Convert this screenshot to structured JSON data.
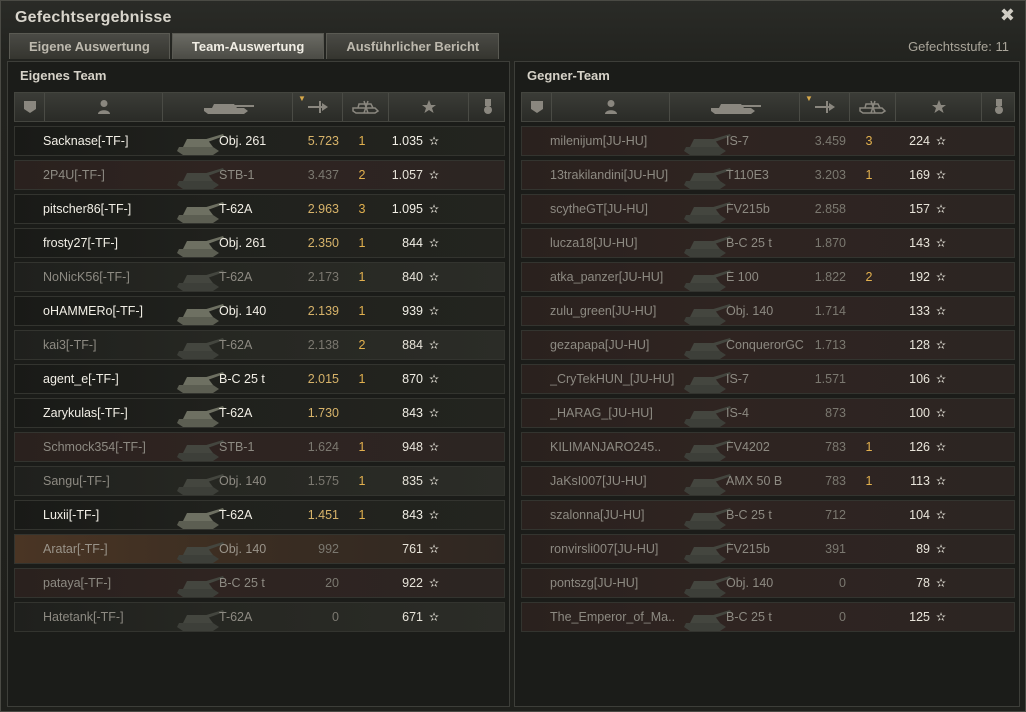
{
  "window": {
    "title": "Gefechtsergebnisse",
    "close_glyph": "✖",
    "tier_label": "Gefechtsstufe: 11"
  },
  "tabs": [
    {
      "label": "Eigene Auswertung",
      "active": false
    },
    {
      "label": "Team-Auswertung",
      "active": true
    },
    {
      "label": "Ausführlicher Bericht",
      "active": false
    }
  ],
  "columns": [
    {
      "icon": "squad-icon"
    },
    {
      "icon": "player-icon"
    },
    {
      "icon": "tank-icon"
    },
    {
      "icon": "damage-icon",
      "sorted": true
    },
    {
      "icon": "kills-icon"
    },
    {
      "icon": "xp-star-icon"
    },
    {
      "icon": "medal-icon"
    }
  ],
  "own_team": {
    "title": "Eigenes Team",
    "players": [
      {
        "name": "Sacknase[-TF-]",
        "tank": "Obj. 261",
        "damage": "5.723",
        "kills": "1",
        "xp": "1.035",
        "alive": true
      },
      {
        "name": "2P4U[-TF-]",
        "tank": "STB-1",
        "damage": "3.437",
        "kills": "2",
        "xp": "1.057",
        "alive": false
      },
      {
        "name": "pitscher86[-TF-]",
        "tank": "T-62A",
        "damage": "2.963",
        "kills": "3",
        "xp": "1.095",
        "alive": true
      },
      {
        "name": "frosty27[-TF-]",
        "tank": "Obj. 261",
        "damage": "2.350",
        "kills": "1",
        "xp": "844",
        "alive": true
      },
      {
        "name": "NoNicK56[-TF-]",
        "tank": "T-62A",
        "damage": "2.173",
        "kills": "1",
        "xp": "840",
        "alive": false
      },
      {
        "name": "oHAMMERo[-TF-]",
        "tank": "Obj. 140",
        "damage": "2.139",
        "kills": "1",
        "xp": "939",
        "alive": true
      },
      {
        "name": "kai3[-TF-]",
        "tank": "T-62A",
        "damage": "2.138",
        "kills": "2",
        "xp": "884",
        "alive": false
      },
      {
        "name": "agent_e[-TF-]",
        "tank": "B-C 25 t",
        "damage": "2.015",
        "kills": "1",
        "xp": "870",
        "alive": true
      },
      {
        "name": "Zarykulas[-TF-]",
        "tank": "T-62A",
        "damage": "1.730",
        "kills": "",
        "xp": "843",
        "alive": true
      },
      {
        "name": "Schmock354[-TF-]",
        "tank": "STB-1",
        "damage": "1.624",
        "kills": "1",
        "xp": "948",
        "alive": false
      },
      {
        "name": "Sangu[-TF-]",
        "tank": "Obj. 140",
        "damage": "1.575",
        "kills": "1",
        "xp": "835",
        "alive": false
      },
      {
        "name": "Luxii[-TF-]",
        "tank": "T-62A",
        "damage": "1.451",
        "kills": "1",
        "xp": "843",
        "alive": true
      },
      {
        "name": "Aratar[-TF-]",
        "tank": "Obj. 140",
        "damage": "992",
        "kills": "",
        "xp": "761",
        "alive": false,
        "highlight": true
      },
      {
        "name": "pataya[-TF-]",
        "tank": "B-C 25 t",
        "damage": "20",
        "kills": "",
        "xp": "922",
        "alive": false
      },
      {
        "name": "Hatetank[-TF-]",
        "tank": "T-62A",
        "damage": "0",
        "kills": "",
        "xp": "671",
        "alive": false
      }
    ]
  },
  "enemy_team": {
    "title": "Gegner-Team",
    "players": [
      {
        "name": "milenijum[JU-HU]",
        "tank": "IS-7",
        "damage": "3.459",
        "kills": "3",
        "xp": "224",
        "alive": false
      },
      {
        "name": "13trakilandini[JU-HU]",
        "tank": "T110E3",
        "damage": "3.203",
        "kills": "1",
        "xp": "169",
        "alive": false
      },
      {
        "name": "scytheGT[JU-HU]",
        "tank": "FV215b",
        "damage": "2.858",
        "kills": "",
        "xp": "157",
        "alive": false
      },
      {
        "name": "lucza18[JU-HU]",
        "tank": "B-C 25 t",
        "damage": "1.870",
        "kills": "",
        "xp": "143",
        "alive": false
      },
      {
        "name": "atka_panzer[JU-HU]",
        "tank": "E 100",
        "damage": "1.822",
        "kills": "2",
        "xp": "192",
        "alive": false
      },
      {
        "name": "zulu_green[JU-HU]",
        "tank": "Obj. 140",
        "damage": "1.714",
        "kills": "",
        "xp": "133",
        "alive": false
      },
      {
        "name": "gezapapa[JU-HU]",
        "tank": "ConquerorGC",
        "damage": "1.713",
        "kills": "",
        "xp": "128",
        "alive": false
      },
      {
        "name": "_CryTekHUN_[JU-HU]",
        "tank": "IS-7",
        "damage": "1.571",
        "kills": "",
        "xp": "106",
        "alive": false
      },
      {
        "name": "_HARAG_[JU-HU]",
        "tank": "IS-4",
        "damage": "873",
        "kills": "",
        "xp": "100",
        "alive": false
      },
      {
        "name": "KILIMANJARO245..",
        "tank": "FV4202",
        "damage": "783",
        "kills": "1",
        "xp": "126",
        "alive": false
      },
      {
        "name": "JaKsI007[JU-HU]",
        "tank": "AMX 50 B",
        "damage": "783",
        "kills": "1",
        "xp": "113",
        "alive": false
      },
      {
        "name": "szalonna[JU-HU]",
        "tank": "B-C 25 t",
        "damage": "712",
        "kills": "",
        "xp": "104",
        "alive": false
      },
      {
        "name": "ronvirsli007[JU-HU]",
        "tank": "FV215b",
        "damage": "391",
        "kills": "",
        "xp": "89",
        "alive": false
      },
      {
        "name": "pontszg[JU-HU]",
        "tank": "Obj. 140",
        "damage": "0",
        "kills": "",
        "xp": "78",
        "alive": false
      },
      {
        "name": "The_Emperor_of_Ma..",
        "tank": "B-C 25 t",
        "damage": "0",
        "kills": "",
        "xp": "125",
        "alive": false
      }
    ]
  },
  "star_glyph": "✫"
}
